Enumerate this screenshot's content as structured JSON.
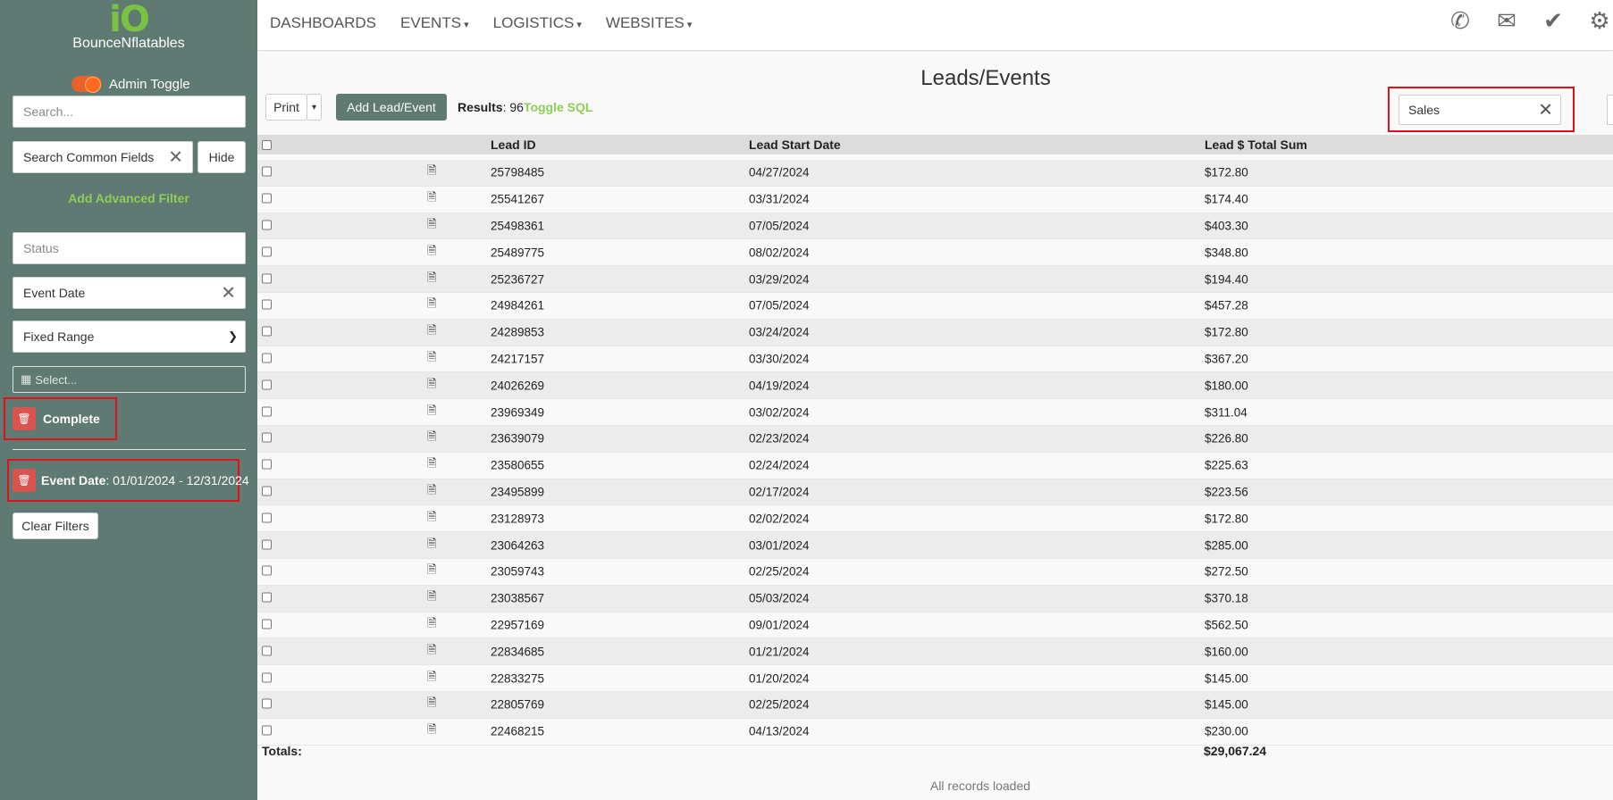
{
  "brand": {
    "logo": "iO",
    "name": "BounceNflatables"
  },
  "sidebar": {
    "admin_toggle_label": "Admin Toggle",
    "search_placeholder": "Search...",
    "common_fields_placeholder": "Search Common Fields",
    "hide_label": "Hide",
    "add_advanced_filter": "Add Advanced Filter",
    "status_placeholder": "Status",
    "event_date_field": "Event Date",
    "range_select": "Fixed Range",
    "date_select_placeholder": "Select...",
    "chip_complete": "Complete",
    "chip_event_date_label": "Event Date",
    "chip_event_date_value": ": 01/01/2024 - 12/31/2024",
    "clear_filters": "Clear Filters"
  },
  "nav": {
    "items": [
      "DASHBOARDS",
      "EVENTS",
      "LOGISTICS",
      "WEBSITES"
    ],
    "icons": [
      "phone-icon",
      "envelope-icon",
      "check-icon",
      "gear-icon"
    ]
  },
  "main": {
    "title": "Leads/Events",
    "print_label": "Print",
    "add_label": "Add Lead/Event",
    "results_label": "Results",
    "results_count": ": 96",
    "toggle_sql": "Toggle SQL",
    "search_value": "Sales"
  },
  "table": {
    "headers": [
      "Lead ID",
      "Lead Start Date",
      "Lead $ Total Sum"
    ],
    "rows": [
      [
        "25798485",
        "04/27/2024",
        "$172.80"
      ],
      [
        "25541267",
        "03/31/2024",
        "$174.40"
      ],
      [
        "25498361",
        "07/05/2024",
        "$403.30"
      ],
      [
        "25489775",
        "08/02/2024",
        "$348.80"
      ],
      [
        "25236727",
        "03/29/2024",
        "$194.40"
      ],
      [
        "24984261",
        "07/05/2024",
        "$457.28"
      ],
      [
        "24289853",
        "03/24/2024",
        "$172.80"
      ],
      [
        "24217157",
        "03/30/2024",
        "$367.20"
      ],
      [
        "24026269",
        "04/19/2024",
        "$180.00"
      ],
      [
        "23969349",
        "03/02/2024",
        "$311.04"
      ],
      [
        "23639079",
        "02/23/2024",
        "$226.80"
      ],
      [
        "23580655",
        "02/24/2024",
        "$225.63"
      ],
      [
        "23495899",
        "02/17/2024",
        "$223.56"
      ],
      [
        "23128973",
        "02/02/2024",
        "$172.80"
      ],
      [
        "23064263",
        "03/01/2024",
        "$285.00"
      ],
      [
        "23059743",
        "02/25/2024",
        "$272.50"
      ],
      [
        "23038567",
        "05/03/2024",
        "$370.18"
      ],
      [
        "22957169",
        "09/01/2024",
        "$562.50"
      ],
      [
        "22834685",
        "01/21/2024",
        "$160.00"
      ],
      [
        "22833275",
        "01/20/2024",
        "$145.00"
      ],
      [
        "22805769",
        "02/25/2024",
        "$145.00"
      ],
      [
        "22468215",
        "04/13/2024",
        "$230.00"
      ]
    ],
    "totals_label": "Totals:",
    "totals_value": "$29,067.24",
    "footer": "All records loaded"
  },
  "colors": {
    "sidebar": "#5f7a72",
    "accent_green": "#8fce55",
    "highlight_box": "#e0101a",
    "delete_red": "#d9534f"
  }
}
